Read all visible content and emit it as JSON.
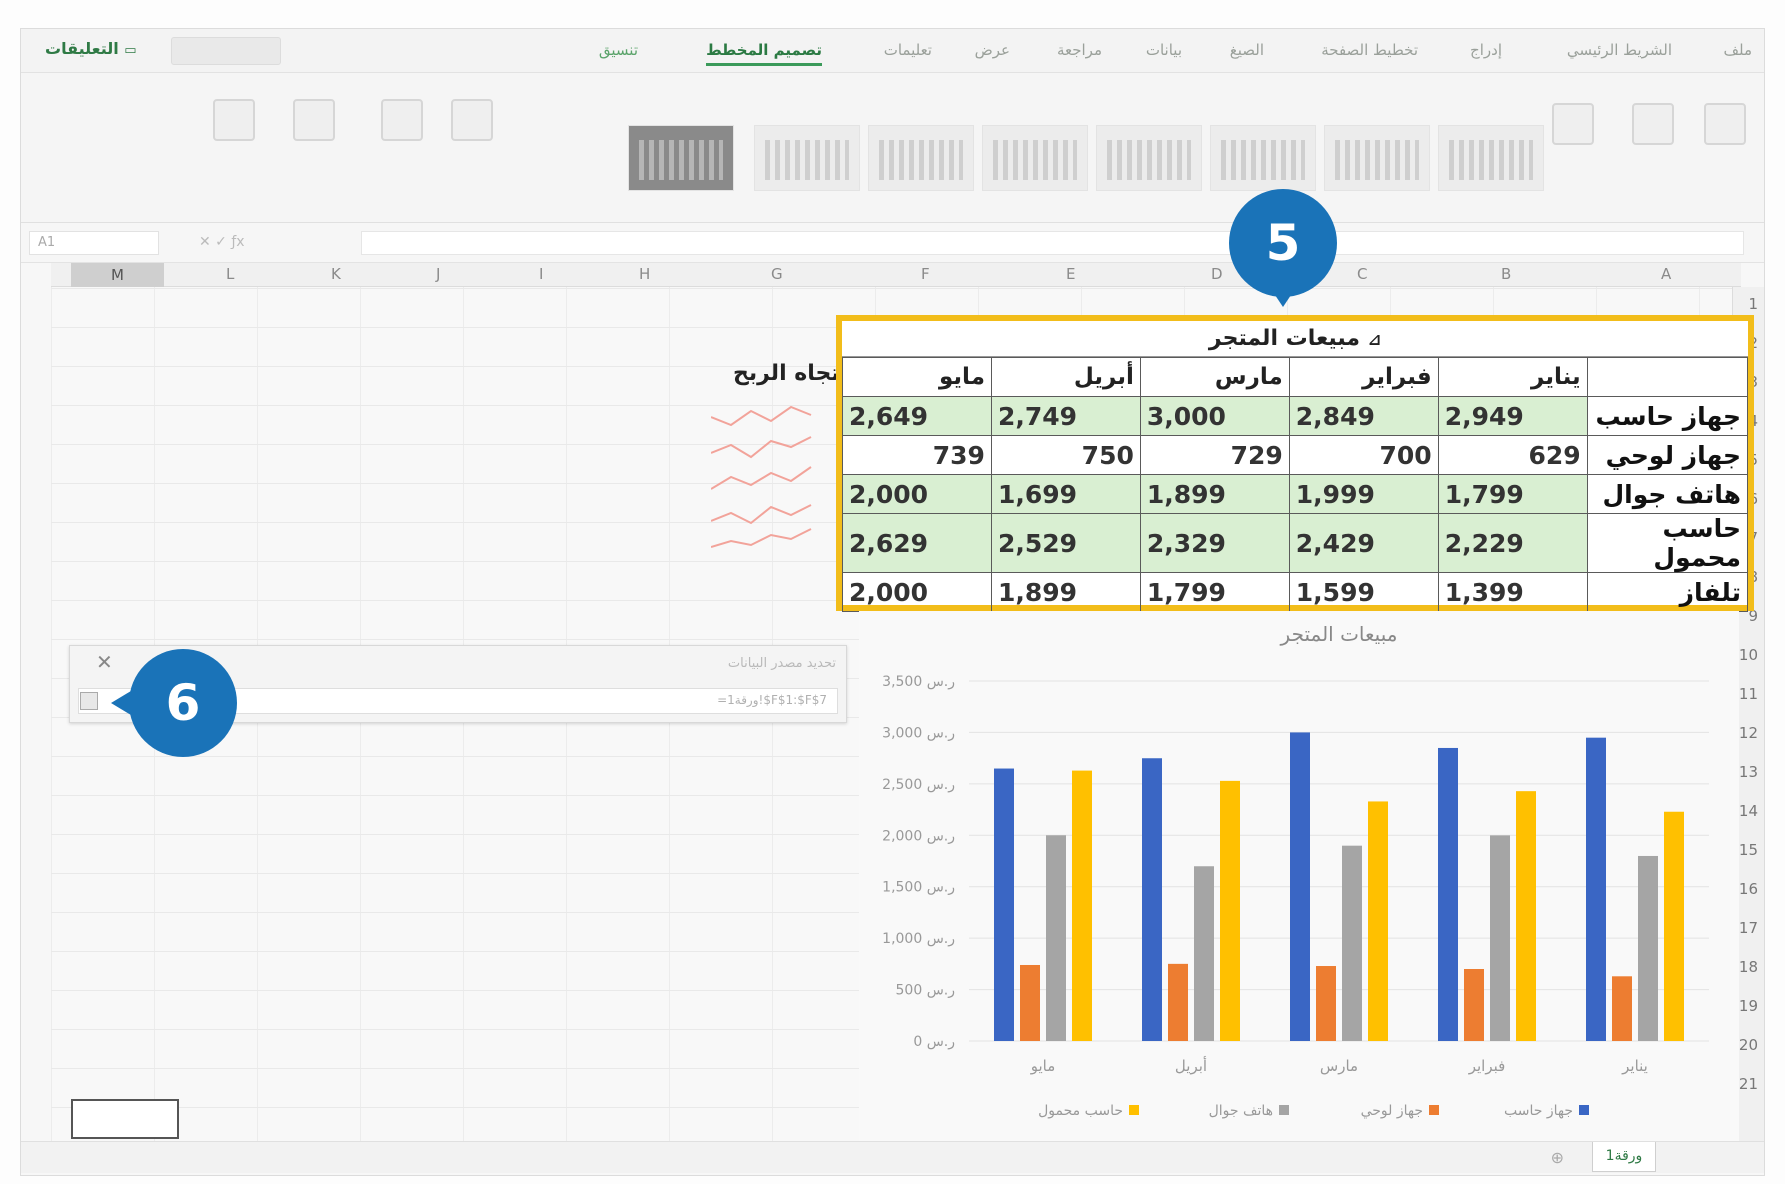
{
  "ribbon": {
    "tabs": [
      "ملف",
      "الشريط الرئيسي",
      "إدراج",
      "تخطيط الصفحة",
      "الصيغ",
      "بيانات",
      "مراجعة",
      "عرض",
      "تعليمات",
      "تصميم المخطط",
      "تنسيق"
    ],
    "active_tab": "تصميم المخطط",
    "comments_label": "التعليقات"
  },
  "badges": {
    "step5": "5",
    "step6": "6"
  },
  "columns": [
    "A",
    "B",
    "C",
    "D",
    "E",
    "F",
    "G",
    "H",
    "I",
    "J",
    "K",
    "L",
    "M"
  ],
  "rows": [
    "1",
    "2",
    "3",
    "4",
    "5",
    "6",
    "7",
    "8",
    "9",
    "10",
    "11",
    "12",
    "13",
    "14",
    "15",
    "16",
    "17",
    "18",
    "19",
    "20",
    "21"
  ],
  "table": {
    "title": "مبيعات المتجر",
    "headers": [
      "",
      "يناير",
      "فبراير",
      "مارس",
      "أبريل",
      "مايو"
    ],
    "rows": [
      {
        "label": "جهاز حاسب",
        "values": [
          "2,949",
          "2,849",
          "3,000",
          "2,749",
          "2,649"
        ]
      },
      {
        "label": "جهاز لوحي",
        "values": [
          "629",
          "700",
          "729",
          "750",
          "739"
        ]
      },
      {
        "label": "هاتف جوال",
        "values": [
          "1,799",
          "1,999",
          "1,899",
          "1,699",
          "2,000"
        ]
      },
      {
        "label": "حاسب محمول",
        "values": [
          "2,229",
          "2,429",
          "2,329",
          "2,529",
          "2,629"
        ]
      },
      {
        "label": "تلفاز",
        "values": [
          "1,399",
          "1,599",
          "1,799",
          "1,899",
          "2,000"
        ]
      }
    ]
  },
  "sparkline_title": "اتجاه الربح",
  "dialog": {
    "title": "تحديد مصدر البيانات",
    "close_glyph": "✕",
    "input_value": "=ورقة1!$F$1:$F$7"
  },
  "sheet_tab": "ورقة1",
  "chart_data": {
    "type": "bar",
    "title": "مبيعات المتجر",
    "categories": [
      "يناير",
      "فبراير",
      "مارس",
      "أبريل",
      "مايو"
    ],
    "series": [
      {
        "name": "جهاز حاسب",
        "color": "#3a66c4",
        "values": [
          2949,
          2849,
          3000,
          2749,
          2649
        ]
      },
      {
        "name": "جهاز لوحي",
        "color": "#ed7d31",
        "values": [
          629,
          700,
          729,
          750,
          739
        ]
      },
      {
        "name": "هاتف جوال",
        "color": "#a5a5a5",
        "values": [
          1799,
          1999,
          1899,
          1699,
          2000
        ]
      },
      {
        "name": "حاسب محمول",
        "color": "#ffc000",
        "values": [
          2229,
          2429,
          2329,
          2529,
          2629
        ]
      }
    ],
    "yticks": [
      "0 ر.س",
      "500 ر.س",
      "1,000 ر.س",
      "1,500 ر.س",
      "2,000 ر.س",
      "2,500 ر.س",
      "3,000 ر.س",
      "3,500 ر.س"
    ],
    "ylim": [
      0,
      3500
    ],
    "grid": true,
    "legend": "bottom"
  }
}
